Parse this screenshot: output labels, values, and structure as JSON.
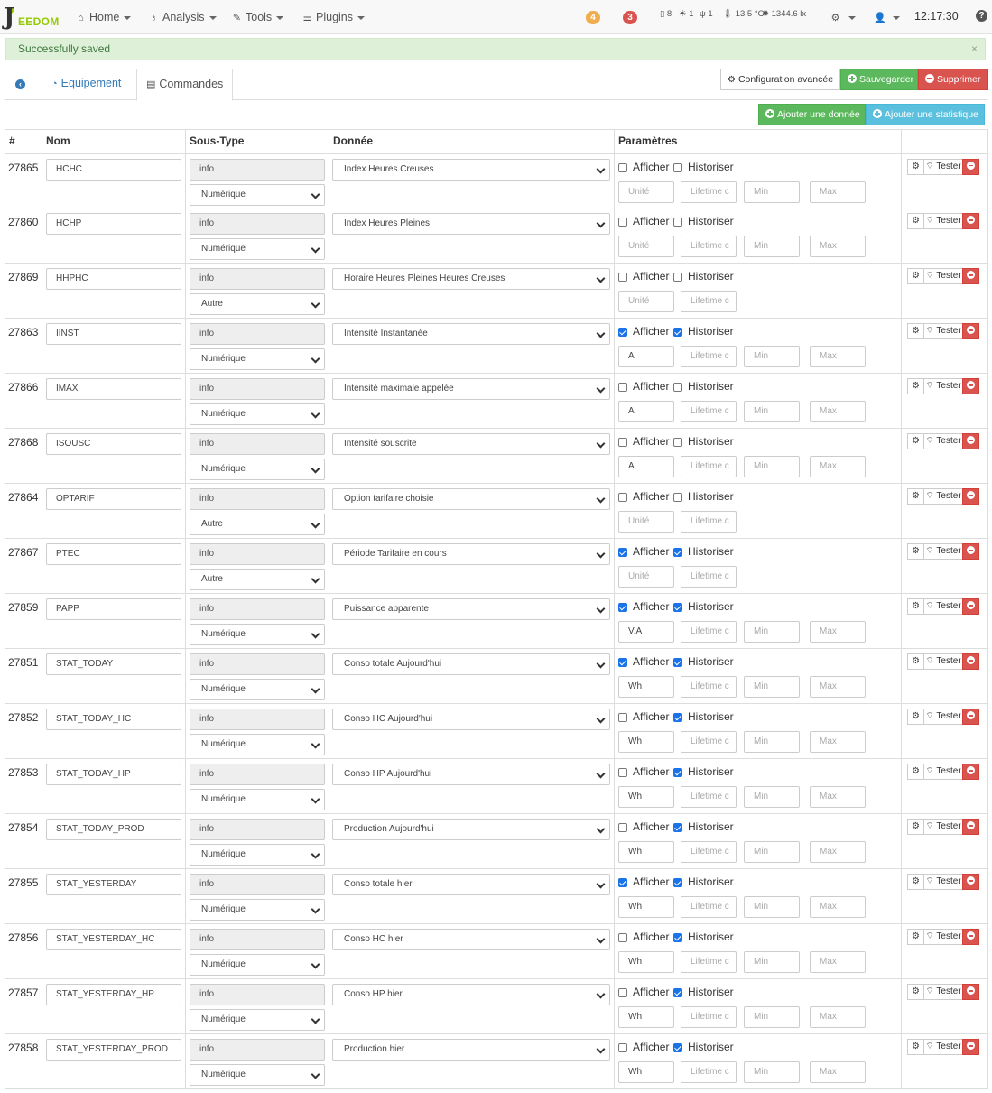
{
  "navbar": {
    "logo_text": "EEDOM",
    "logo_letter": "J",
    "menus": [
      {
        "label": "Home",
        "icon": "home-icon"
      },
      {
        "label": "Analysis",
        "icon": "stethoscope-icon"
      },
      {
        "label": "Tools",
        "icon": "wrench-icon"
      },
      {
        "label": "Plugins",
        "icon": "list-icon"
      }
    ],
    "badge_orange": "4",
    "badge_red": "3",
    "status_1": "8",
    "status_2": "1",
    "status_3": "1",
    "temperature": "13.5 °C",
    "luminosity": "1344.6 lx",
    "time": "12:17:30",
    "colors": {
      "badge_orange": "#f0ad4e",
      "badge_red": "#d9534f"
    }
  },
  "alert": {
    "message": "Successfully saved",
    "close": "×"
  },
  "tabs": {
    "equipement": "Equipement",
    "commandes": "Commandes"
  },
  "actions": {
    "config": "Configuration avancée",
    "save": "Sauvegarder",
    "delete": "Supprimer",
    "add_data": "Ajouter une donnée",
    "add_stat": "Ajouter une statistique"
  },
  "table": {
    "headers": [
      "#",
      "Nom",
      "Sous-Type",
      "Donnée",
      "Paramètres",
      ""
    ],
    "labels": {
      "afficher": "Afficher",
      "historiser": "Historiser",
      "tester": "Tester",
      "type_value": "info",
      "ph_unit": "Unité",
      "ph_lifetime": "Lifetime c",
      "ph_min": "Min",
      "ph_max": "Max"
    },
    "rows": [
      {
        "id": "27865",
        "name": "HCHC",
        "subtype": "Numérique",
        "data": "Index Heures Creuses",
        "show": false,
        "hist": false,
        "unit": "",
        "minmax": true
      },
      {
        "id": "27860",
        "name": "HCHP",
        "subtype": "Numérique",
        "data": "Index Heures Pleines",
        "show": false,
        "hist": false,
        "unit": "",
        "minmax": true
      },
      {
        "id": "27869",
        "name": "HHPHC",
        "subtype": "Autre",
        "data": "Horaire Heures Pleines Heures Creuses",
        "show": false,
        "hist": false,
        "unit": "",
        "minmax": false
      },
      {
        "id": "27863",
        "name": "IINST",
        "subtype": "Numérique",
        "data": "Intensité Instantanée",
        "show": true,
        "hist": true,
        "unit": "A",
        "minmax": true
      },
      {
        "id": "27866",
        "name": "IMAX",
        "subtype": "Numérique",
        "data": "Intensité maximale appelée",
        "show": false,
        "hist": false,
        "unit": "A",
        "minmax": true
      },
      {
        "id": "27868",
        "name": "ISOUSC",
        "subtype": "Numérique",
        "data": "Intensité souscrite",
        "show": false,
        "hist": false,
        "unit": "A",
        "minmax": true
      },
      {
        "id": "27864",
        "name": "OPTARIF",
        "subtype": "Autre",
        "data": "Option tarifaire choisie",
        "show": false,
        "hist": false,
        "unit": "",
        "minmax": false
      },
      {
        "id": "27867",
        "name": "PTEC",
        "subtype": "Autre",
        "data": "Période Tarifaire en cours",
        "show": true,
        "hist": true,
        "unit": "",
        "minmax": false
      },
      {
        "id": "27859",
        "name": "PAPP",
        "subtype": "Numérique",
        "data": "Puissance apparente",
        "show": true,
        "hist": true,
        "unit": "V.A",
        "minmax": true
      },
      {
        "id": "27851",
        "name": "STAT_TODAY",
        "subtype": "Numérique",
        "data": "Conso totale Aujourd'hui",
        "show": true,
        "hist": true,
        "unit": "Wh",
        "minmax": true
      },
      {
        "id": "27852",
        "name": "STAT_TODAY_HC",
        "subtype": "Numérique",
        "data": "Conso HC Aujourd'hui",
        "show": false,
        "hist": true,
        "unit": "Wh",
        "minmax": true
      },
      {
        "id": "27853",
        "name": "STAT_TODAY_HP",
        "subtype": "Numérique",
        "data": "Conso HP Aujourd'hui",
        "show": false,
        "hist": true,
        "unit": "Wh",
        "minmax": true
      },
      {
        "id": "27854",
        "name": "STAT_TODAY_PROD",
        "subtype": "Numérique",
        "data": "Production Aujourd'hui",
        "show": false,
        "hist": true,
        "unit": "Wh",
        "minmax": true
      },
      {
        "id": "27855",
        "name": "STAT_YESTERDAY",
        "subtype": "Numérique",
        "data": "Conso totale hier",
        "show": true,
        "hist": true,
        "unit": "Wh",
        "minmax": true
      },
      {
        "id": "27856",
        "name": "STAT_YESTERDAY_HC",
        "subtype": "Numérique",
        "data": "Conso HC hier",
        "show": false,
        "hist": true,
        "unit": "Wh",
        "minmax": true
      },
      {
        "id": "27857",
        "name": "STAT_YESTERDAY_HP",
        "subtype": "Numérique",
        "data": "Conso HP hier",
        "show": false,
        "hist": true,
        "unit": "Wh",
        "minmax": true
      },
      {
        "id": "27858",
        "name": "STAT_YESTERDAY_PROD",
        "subtype": "Numérique",
        "data": "Production hier",
        "show": false,
        "hist": true,
        "unit": "Wh",
        "minmax": true
      }
    ]
  }
}
